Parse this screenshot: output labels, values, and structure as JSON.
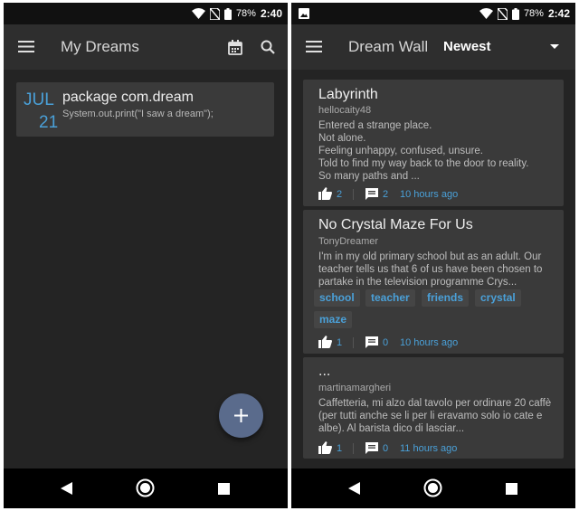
{
  "left_screen": {
    "status": {
      "battery": "78%",
      "time": "2:40"
    },
    "app_bar": {
      "title": "My Dreams",
      "icons": [
        "menu-icon",
        "calendar-icon",
        "search-icon"
      ]
    },
    "dream": {
      "month": "JUL",
      "day": "21",
      "title": "package com.dream",
      "text": "System.out.print(\"I saw a dream\");"
    },
    "fab_icon": "add-icon"
  },
  "right_screen": {
    "status": {
      "battery": "78%",
      "time": "2:42"
    },
    "app_bar": {
      "title": "Dream Wall",
      "sort_selected": "Newest",
      "icons": [
        "menu-icon",
        "dropdown-arrow-icon"
      ]
    },
    "posts": [
      {
        "title": "Labyrinth",
        "author": "hellocaity48",
        "body": "Entered a strange place.\nNot alone.\nFeeling unhappy, confused, unsure.\nTold to find my way back to the door to reality.\nSo many paths and ...",
        "tags": [],
        "likes": "2",
        "comments": "2",
        "time": "10 hours ago"
      },
      {
        "title": "No Crystal Maze For Us",
        "author": "TonyDreamer",
        "body": "I'm in my old primary school but as an adult. Our teacher tells us that 6 of us have been chosen to partake in the television programme Crys...",
        "tags": [
          "school",
          "teacher",
          "friends",
          "crystal",
          "maze"
        ],
        "likes": "1",
        "comments": "0",
        "time": "10 hours ago"
      },
      {
        "title": "...",
        "author": "martinamargheri",
        "body": "Caffetteria, mi alzo dal tavolo per ordinare 20 caffè (per tutti anche se li per li eravamo solo io cate e albe). Al barista dico di lasciar...",
        "tags": [],
        "likes": "1",
        "comments": "0",
        "time": "11 hours ago"
      }
    ]
  },
  "nav_icons": [
    "back-icon",
    "home-icon",
    "recents-icon"
  ],
  "colors": {
    "accent": "#4aa0d8",
    "background": "#242424",
    "card": "#3a3a3a",
    "app_bar": "#2e2e2e",
    "fab": "#5a6b8c"
  }
}
